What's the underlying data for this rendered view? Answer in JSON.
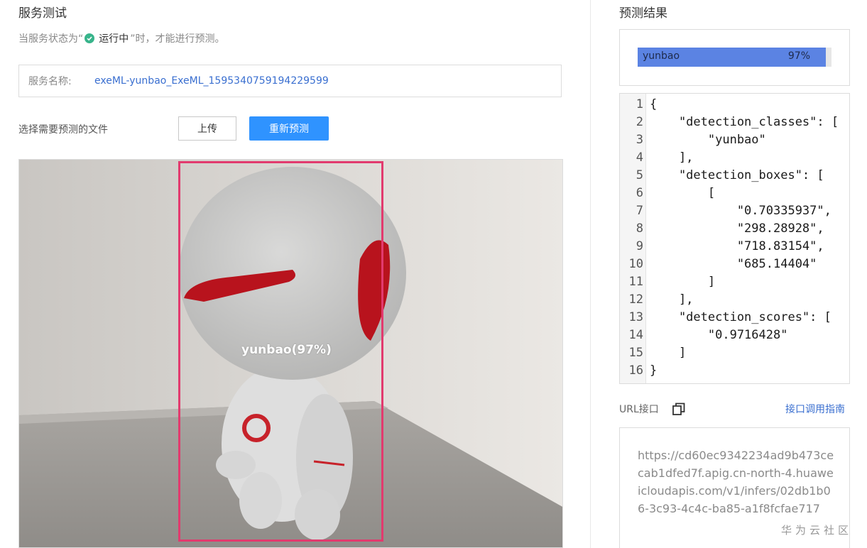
{
  "left": {
    "title": "服务测试",
    "status": {
      "prefix": "当服务状态为“",
      "state": "运行中",
      "suffix": "”时，才能进行预测。"
    },
    "service": {
      "label": "服务名称:",
      "value": "exeML-yunbao_ExeML_1595340759194229599"
    },
    "select_label": "选择需要预测的文件",
    "upload_button": "上传",
    "repredict_button": "重新预测",
    "detection": {
      "label": "yunbao(97%)"
    }
  },
  "right": {
    "title": "预测结果",
    "result": {
      "name": "yunbao",
      "percent_text": "97%",
      "score": 0.97
    },
    "code_lines": [
      "{",
      "    \"detection_classes\": [",
      "        \"yunbao\"",
      "    ],",
      "    \"detection_boxes\": [",
      "        [",
      "            \"0.70335937\",",
      "            \"298.28928\",",
      "            \"718.83154\",",
      "            \"685.14404\"",
      "        ]",
      "    ],",
      "    \"detection_scores\": [",
      "        \"0.9716428\"",
      "    ]",
      "}"
    ],
    "url_label": "URL接口",
    "guide_link": "接口调用指南",
    "url": "https://cd60ec9342234ad9b473cecab1dfed7f.apig.cn-north-4.huaweicloudapis.com/v1/infers/02db1b06-3c93-4c4c-ba85-a1f8fcfae717"
  },
  "watermark": "华为云社区",
  "colors": {
    "accent": "#2f93ff",
    "link": "#3a6fd0",
    "bar": "#5b83e3",
    "detection_box": "#e23a6e",
    "status_ok": "#38b48b"
  }
}
